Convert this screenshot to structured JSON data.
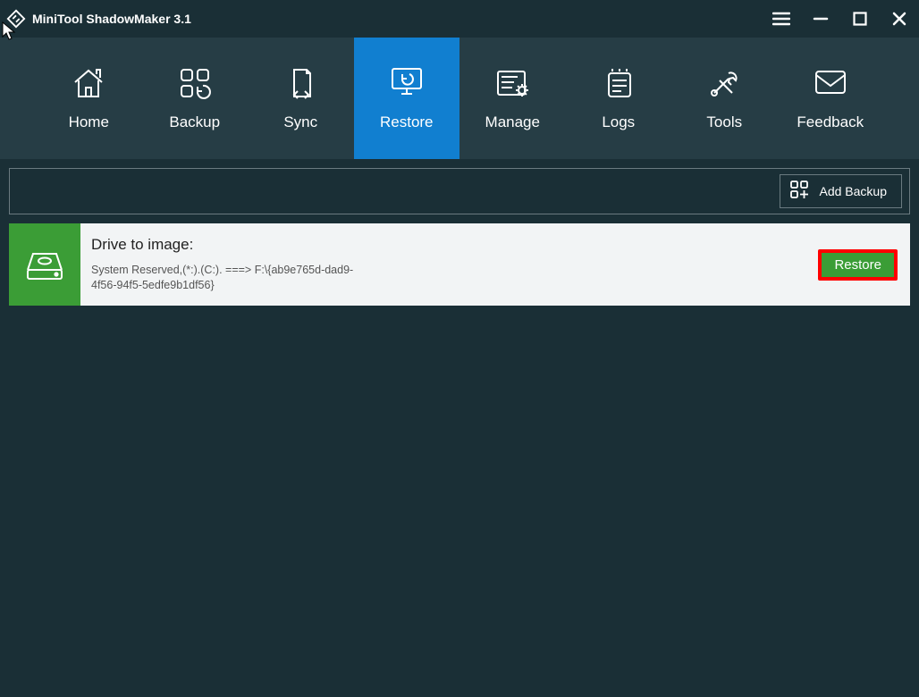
{
  "titlebar": {
    "app_title": "MiniTool ShadowMaker 3.1"
  },
  "nav": {
    "items": [
      {
        "label": "Home"
      },
      {
        "label": "Backup"
      },
      {
        "label": "Sync"
      },
      {
        "label": "Restore"
      },
      {
        "label": "Manage"
      },
      {
        "label": "Logs"
      },
      {
        "label": "Tools"
      },
      {
        "label": "Feedback"
      }
    ],
    "active_index": 3
  },
  "toolbar": {
    "add_backup_label": "Add Backup"
  },
  "list": {
    "items": [
      {
        "title": "Drive to image:",
        "detail": "System Reserved,(*:).(C:). ===> F:\\{ab9e765d-dad9-4f56-94f5-5edfe9b1df56}",
        "action_label": "Restore"
      }
    ]
  },
  "colors": {
    "bg_dark": "#1a2f36",
    "bg_nav": "#263d45",
    "accent_blue": "#117fd0",
    "accent_green": "#3b9d36",
    "highlight_red": "#ff0000"
  }
}
